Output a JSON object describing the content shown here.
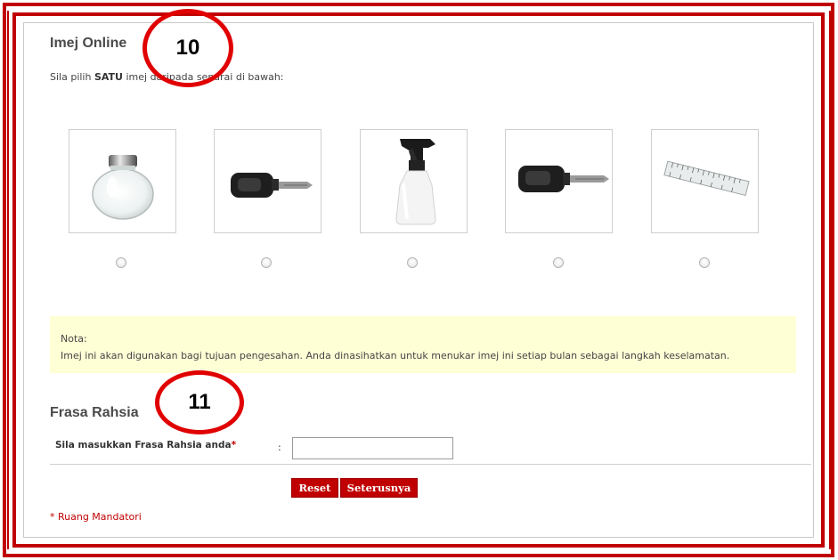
{
  "section": {
    "title": "Imej Online",
    "instruction_prefix": "Sila pilih ",
    "instruction_bold": "SATU",
    "instruction_suffix": " imej daripada senarai di bawah:"
  },
  "images": [
    {
      "icon": "glass-jar"
    },
    {
      "icon": "car-key"
    },
    {
      "icon": "spray-bottle"
    },
    {
      "icon": "car-key"
    },
    {
      "icon": "ruler"
    }
  ],
  "note": {
    "heading": "Nota:",
    "text": "Imej ini akan digunakan bagi tujuan pengesahan. Anda dinasihatkan untuk menukar imej ini setiap bulan sebagai langkah keselamatan."
  },
  "secret": {
    "title": "Frasa Rahsia",
    "label": "Sila masukkan Frasa Rahsia anda",
    "required_mark": "*",
    "colon": ":",
    "value": ""
  },
  "buttons": {
    "reset": "Reset",
    "next": "Seterusnya"
  },
  "mandatory_note": "* Ruang Mandatori",
  "callouts": {
    "first": "10",
    "second": "11"
  },
  "colors": {
    "accent": "#c00000",
    "note_bg": "#ffffd6"
  }
}
